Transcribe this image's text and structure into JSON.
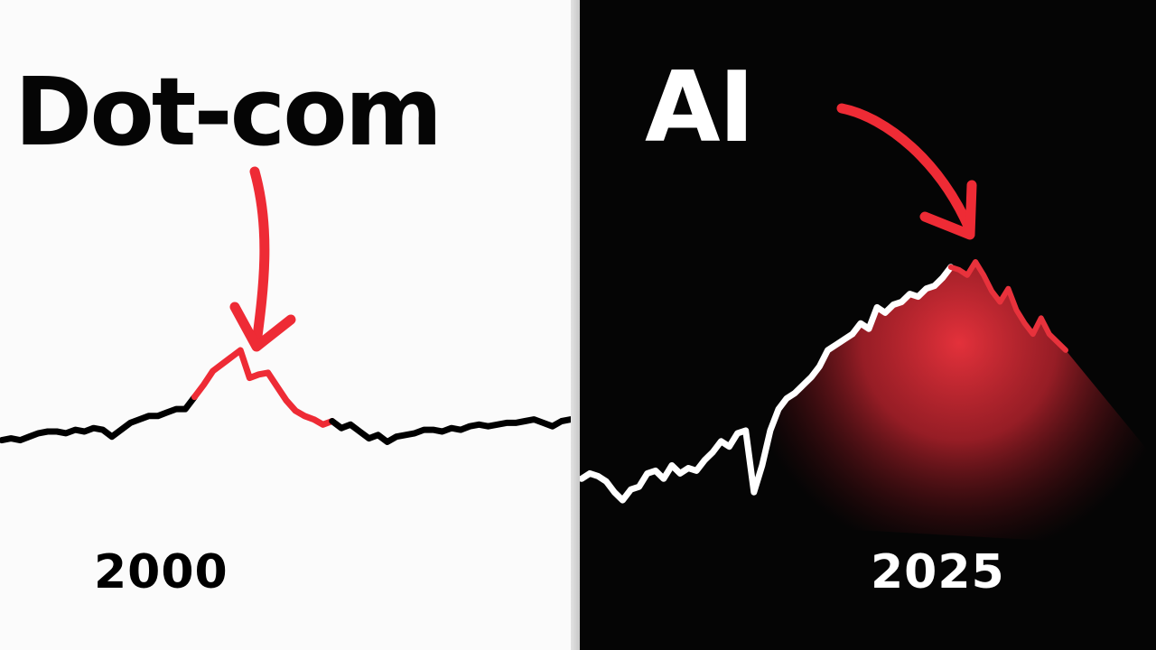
{
  "chart_data": [
    {
      "type": "line",
      "title": "Dot-com",
      "xlabel": "2000",
      "axes": "none",
      "grid": false,
      "legend": "none",
      "colors": {
        "line": "#000000",
        "highlight": "#ee2b35",
        "background": "#fbfbfb",
        "arrow": "#ee2b35"
      },
      "x": [
        0,
        1,
        2,
        3,
        4,
        5,
        6,
        7,
        8,
        9,
        10,
        11,
        12,
        13,
        14,
        15,
        16,
        17,
        18,
        19,
        20,
        21,
        22,
        23,
        24,
        25,
        26,
        27,
        28,
        29,
        30,
        31,
        32,
        33,
        34,
        35,
        36,
        37,
        38,
        39,
        40,
        41,
        42,
        43,
        44,
        45,
        46,
        47,
        48,
        49,
        50,
        51,
        52,
        53,
        54,
        55,
        56,
        57,
        58,
        59,
        60,
        61,
        62
      ],
      "y": [
        30,
        31,
        30,
        32,
        34,
        35,
        35,
        34,
        36,
        35,
        37,
        36,
        32,
        36,
        40,
        42,
        44,
        44,
        46,
        48,
        48,
        55,
        62,
        70,
        74,
        78,
        82,
        66,
        68,
        69,
        61,
        53,
        47,
        44,
        42,
        39,
        41,
        37,
        39,
        35,
        31,
        33,
        29,
        32,
        33,
        34,
        36,
        36,
        35,
        37,
        36,
        38,
        39,
        38,
        39,
        40,
        40,
        41,
        42,
        40,
        38,
        41,
        42
      ],
      "highlight": {
        "from_index": 21,
        "to_index": 36
      },
      "annotation": {
        "type": "arrow",
        "target_index": 27
      }
    },
    {
      "type": "area",
      "title": "AI",
      "xlabel": "2025",
      "axes": "none",
      "grid": false,
      "legend": "none",
      "colors": {
        "line": "#ffffff",
        "highlight": "#e8323c",
        "background": "#050505",
        "arrow": "#ee2b35"
      },
      "x": [
        0,
        1,
        2,
        3,
        4,
        5,
        6,
        7,
        8,
        9,
        10,
        11,
        12,
        13,
        14,
        15,
        16,
        17,
        18,
        19,
        20,
        21,
        22,
        23,
        24,
        25,
        26,
        27,
        28,
        29,
        30,
        31,
        32,
        33,
        34,
        35,
        36,
        37,
        38,
        39,
        40,
        41,
        42,
        43,
        44,
        45,
        46,
        47,
        48,
        49,
        50,
        51,
        52,
        53,
        54,
        55,
        56,
        57,
        58,
        59
      ],
      "y": [
        10,
        12,
        11,
        9,
        5,
        2,
        6,
        7,
        12,
        13,
        10,
        15,
        12,
        14,
        13,
        17,
        20,
        24,
        22,
        27,
        28,
        5,
        15,
        28,
        36,
        40,
        42,
        45,
        48,
        52,
        58,
        60,
        62,
        64,
        68,
        66,
        74,
        72,
        75,
        76,
        79,
        78,
        81,
        82,
        85,
        89,
        88,
        86,
        91,
        86,
        80,
        76,
        81,
        73,
        68,
        64,
        70,
        64,
        61,
        58
      ],
      "area_segment": {
        "from_index": 45,
        "to_index": 59,
        "tail_to": "bottom-right"
      },
      "annotation": {
        "type": "arrow",
        "target_index": 45
      }
    }
  ]
}
